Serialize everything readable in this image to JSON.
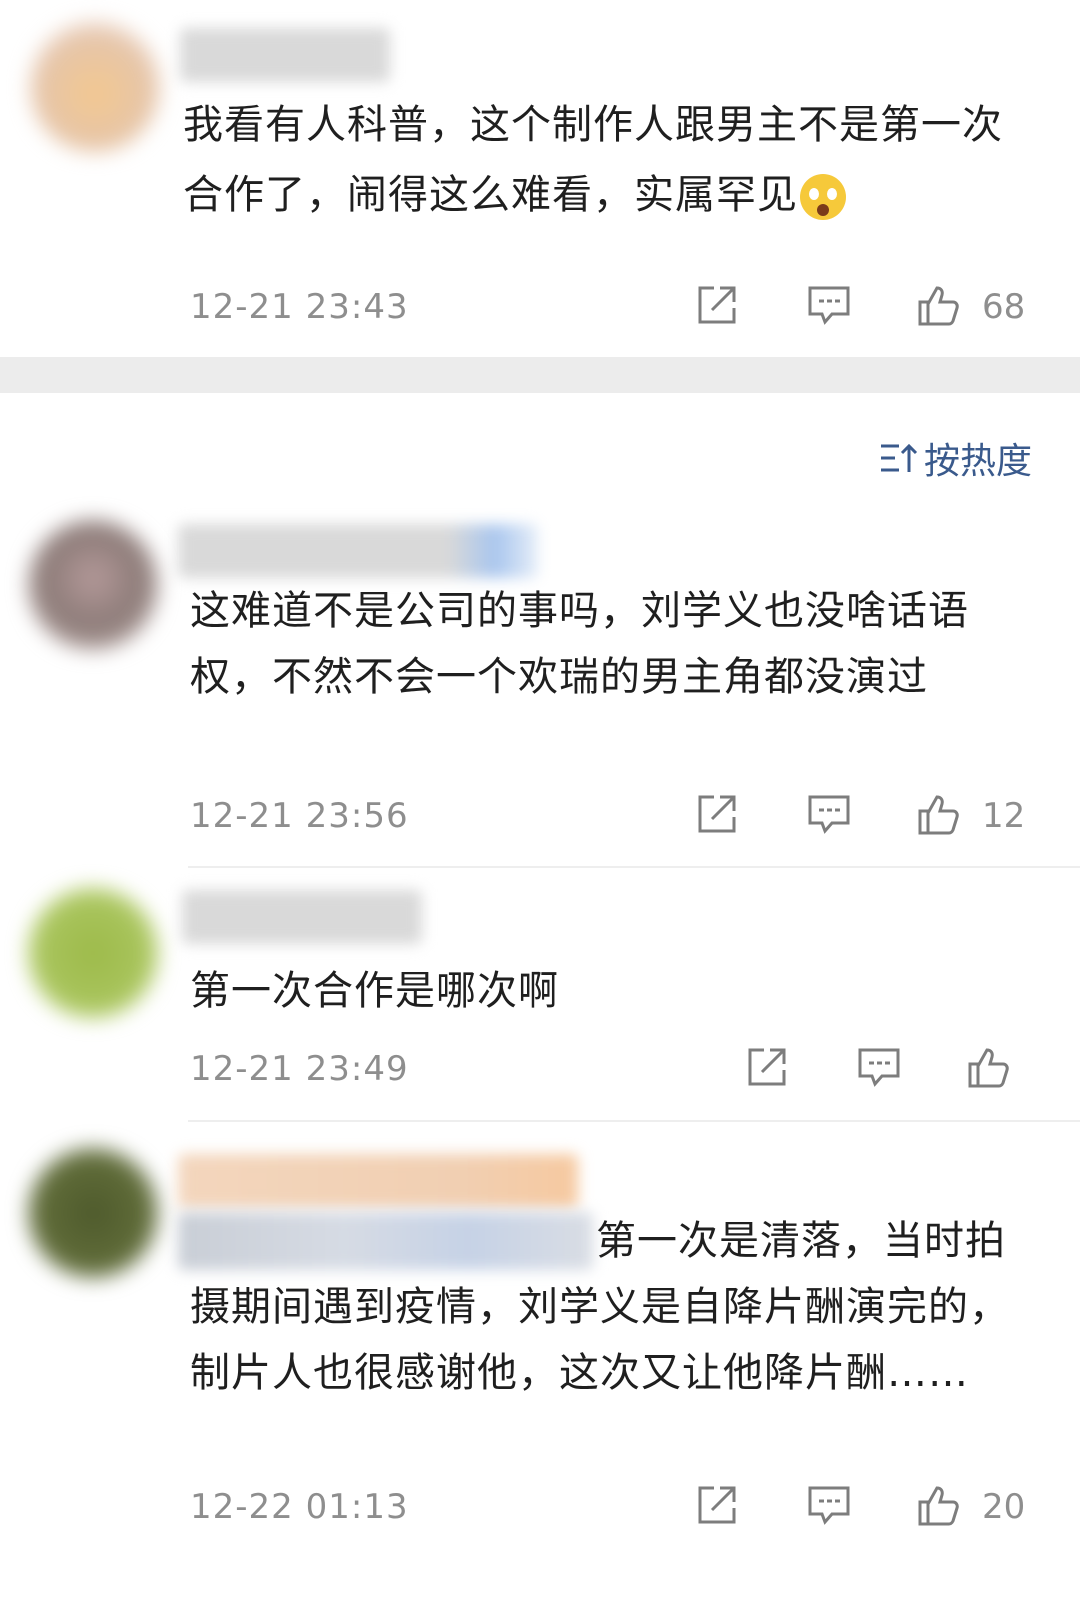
{
  "comments": [
    {
      "text": "我看有人科普，这个制作人跟男主不是第一次合作了，闹得这么难看，实属罕见",
      "emoji": "astonished-face-icon",
      "time": "12-21 23:43",
      "likes": "68"
    },
    {
      "text": "这难道不是公司的事吗，刘学义也没啥话语权，不然不会一个欢瑞的男主角都没演过",
      "time": "12-21 23:56",
      "likes": "12"
    },
    {
      "text": "第一次合作是哪次啊",
      "time": "12-21 23:49",
      "likes": ""
    },
    {
      "text": "第一次是清落，当时拍摄期间遇到疫情，刘学义是自降片酬演完的，制片人也很感谢他，这次又让他降片酬……",
      "time": "12-22 01:13",
      "likes": "20"
    }
  ],
  "sort": {
    "label": "按热度",
    "icon": "sort-icon"
  },
  "icons": {
    "share": "share-icon",
    "reply": "comment-icon",
    "like": "thumbs-up-icon"
  },
  "colors": {
    "accent": "#3a5a8c",
    "meta": "#8e8e8e",
    "divider": "#ececec"
  }
}
